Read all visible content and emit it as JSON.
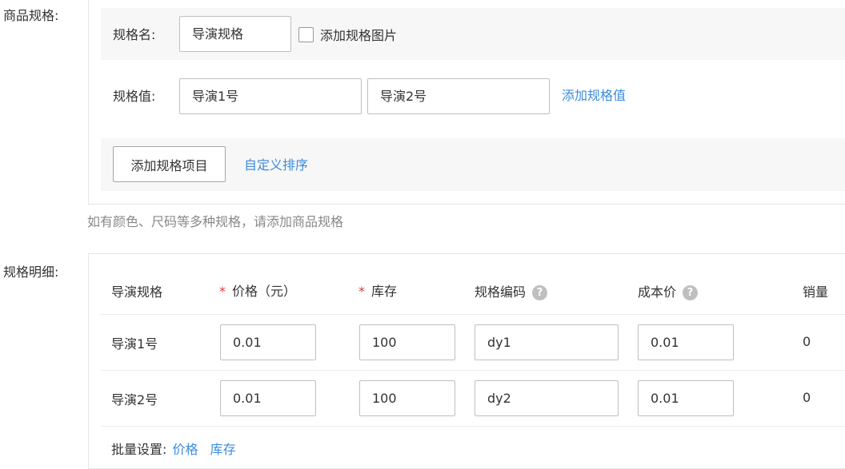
{
  "spec_section": {
    "label": "商品规格:",
    "spec_name": {
      "label": "规格名:",
      "value": "导演规格",
      "add_image_label": "添加规格图片"
    },
    "spec_values": {
      "label": "规格值:",
      "values": [
        "导演1号",
        "导演2号"
      ],
      "add_value_link": "添加规格值"
    },
    "add_item_button": "添加规格项目",
    "custom_sort_link": "自定义排序",
    "hint": "如有颜色、尺码等多种规格，请添加商品规格"
  },
  "detail_section": {
    "label": "规格明细:",
    "headers": {
      "spec": "导演规格",
      "price": "价格（元）",
      "stock": "库存",
      "code": "规格编码",
      "cost": "成本价",
      "sales": "销量"
    },
    "required_mark": "*",
    "help_glyph": "?",
    "rows": [
      {
        "name": "导演1号",
        "price": "0.01",
        "stock": "100",
        "code": "dy1",
        "cost": "0.01",
        "sales": "0"
      },
      {
        "name": "导演2号",
        "price": "0.01",
        "stock": "100",
        "code": "dy2",
        "cost": "0.01",
        "sales": "0"
      }
    ],
    "batch": {
      "label": "批量设置:",
      "price_link": "价格",
      "stock_link": "库存"
    }
  }
}
